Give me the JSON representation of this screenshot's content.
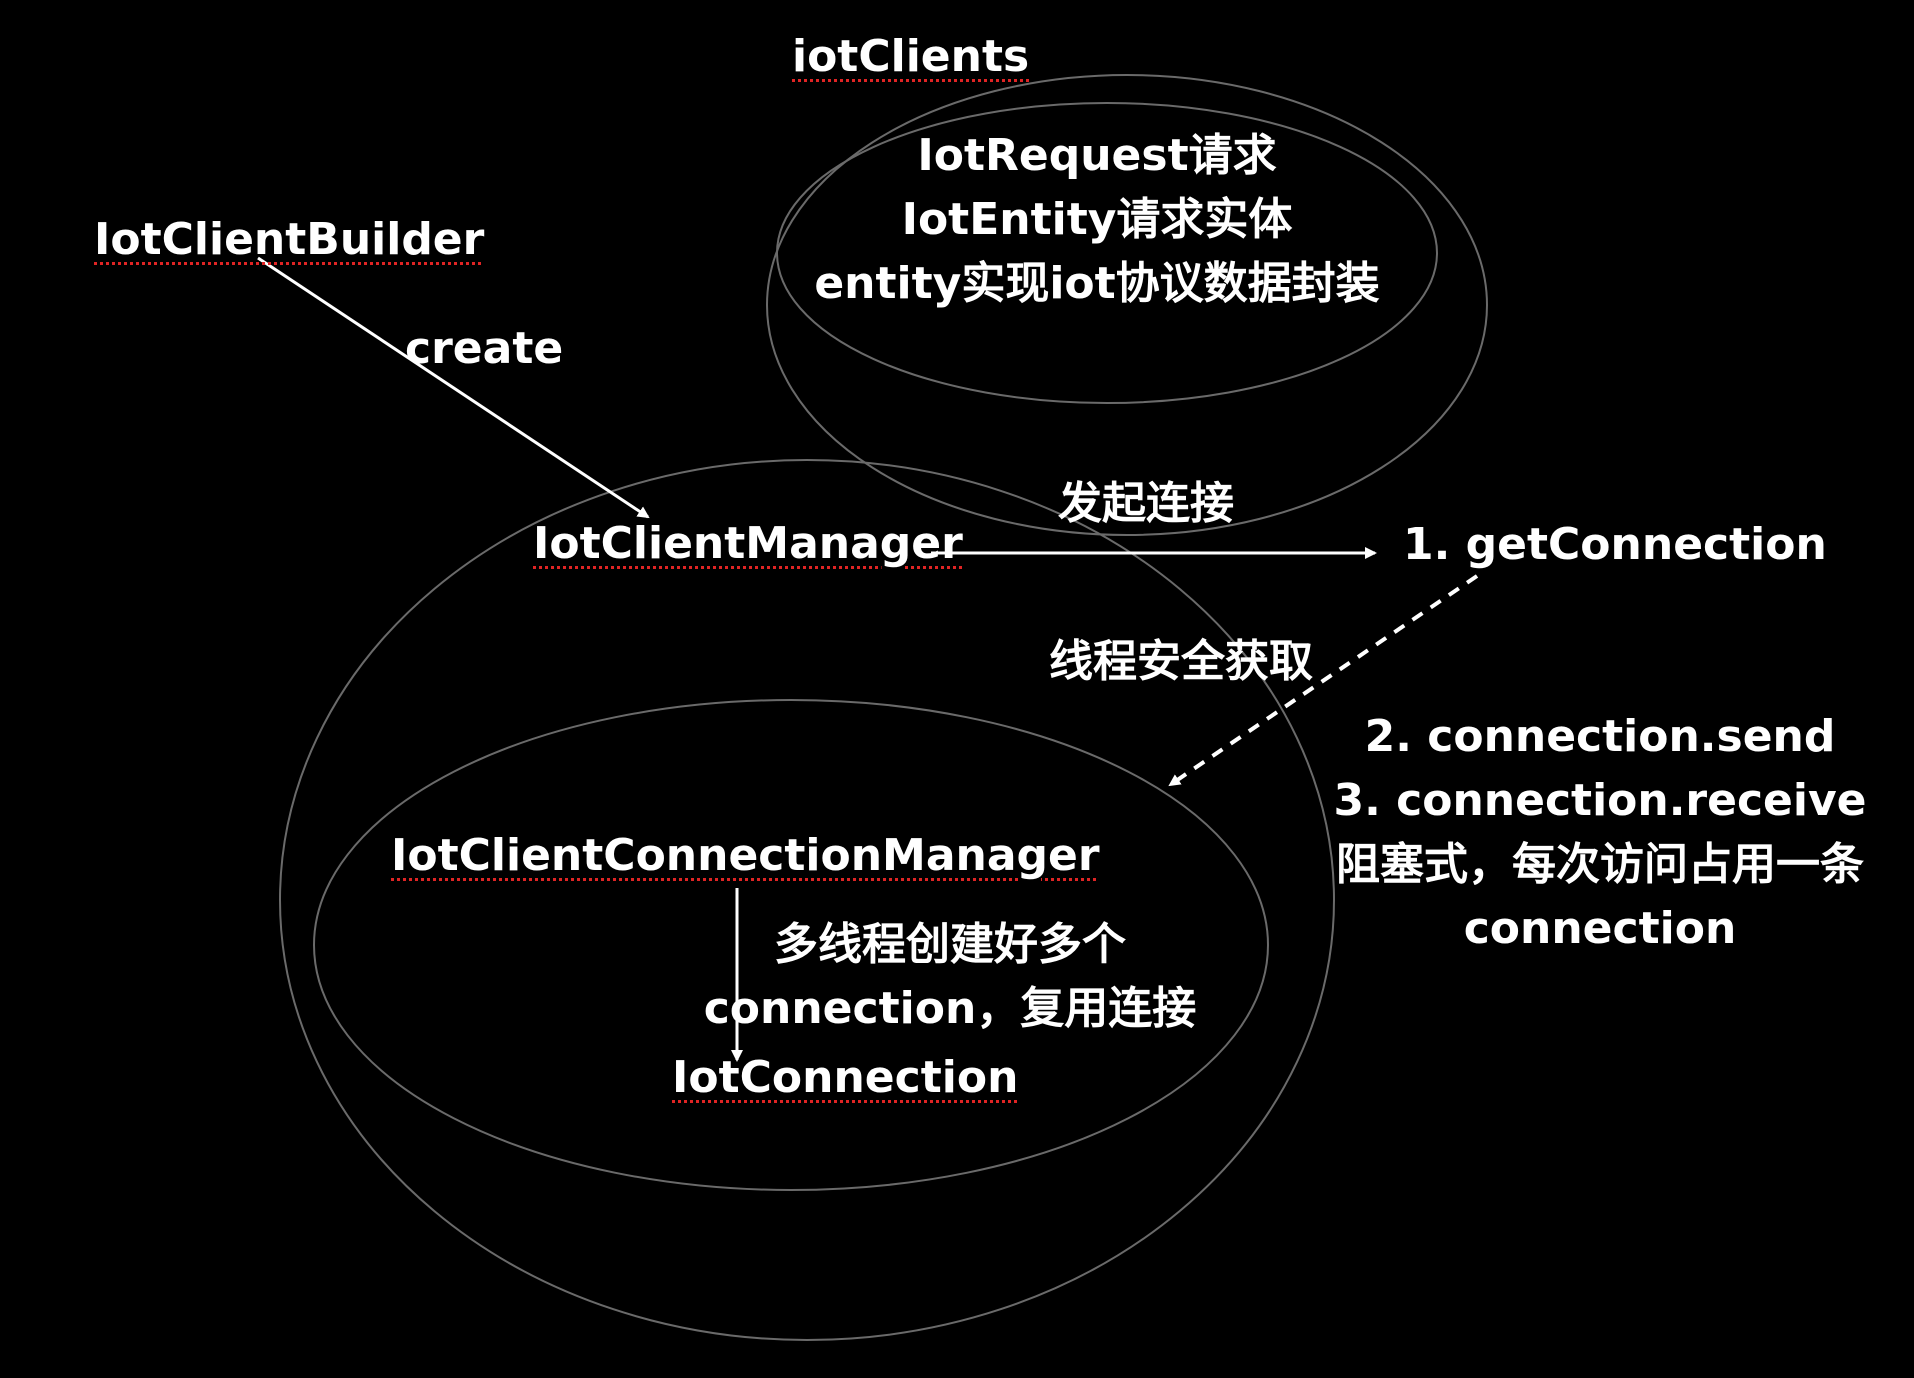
{
  "groups": {
    "iot_clients": "iotClients"
  },
  "nodes": {
    "builder": "IotClientBuilder",
    "manager": "IotClientManager",
    "connection_manager": "IotClientConnectionManager",
    "connection": "IotConnection"
  },
  "request_info": [
    "IotRequest请求",
    "IotEntity请求实体",
    "entity实现iot协议数据封装"
  ],
  "edges": {
    "create": "create",
    "initiate_connection": "发起连接",
    "thread_safe_get": "线程安全获取",
    "multi_thread_create": [
      "多线程创建好多个",
      "connection，复用连接"
    ]
  },
  "steps": {
    "get_connection": "1. getConnection",
    "send_receive": [
      "2. connection.send",
      "3. connection.receive",
      "阻塞式，每次访问占用一条",
      "connection"
    ]
  },
  "colors": {
    "background": "#000000",
    "text": "#ffffff",
    "ellipse_stroke": "#6a6a6a",
    "spellcheck_underline": "#e02424"
  }
}
